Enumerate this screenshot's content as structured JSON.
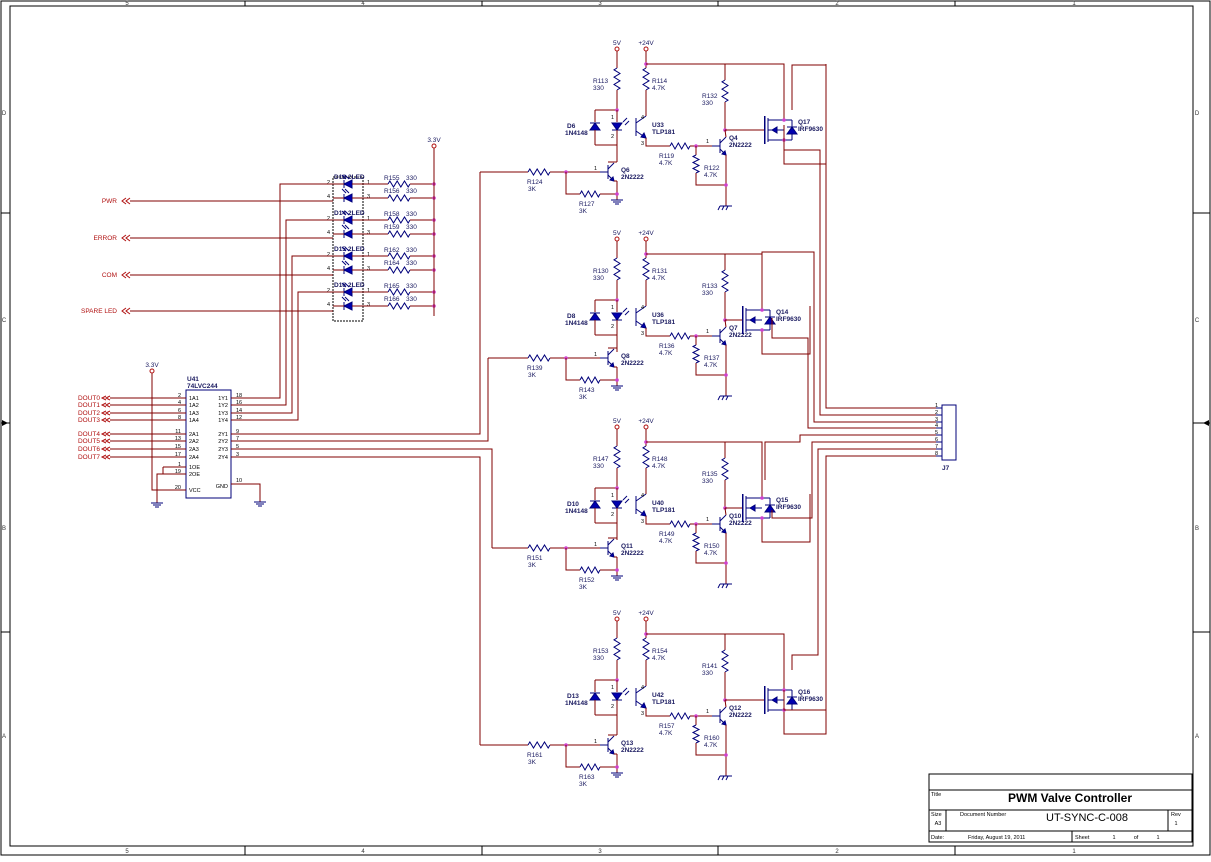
{
  "border": {
    "cols": [
      "5",
      "4",
      "3",
      "2",
      "1"
    ],
    "rows": [
      "D",
      "C",
      "B",
      "A"
    ]
  },
  "title_block": {
    "title_label": "Title",
    "title": "PWM Valve Controller",
    "size_label": "Size",
    "size": "A3",
    "docnum_label": "Document Number",
    "docnum": "UT-SYNC-C-008",
    "rev_label": "Rev",
    "rev": "1",
    "date_label": "Date:",
    "date": "Friday, August 19, 2011",
    "sheet_label": "Sheet",
    "sheet": "1",
    "of_label": "of",
    "of": "1"
  },
  "power": {
    "v33": "3.3V",
    "v5": "5V",
    "v24": "+24V"
  },
  "status_ports": [
    "PWR",
    "ERROR",
    "COM",
    "SPARE LED"
  ],
  "dout_ports": [
    "DOUT0",
    "DOUT1",
    "DOUT2",
    "DOUT3",
    "DOUT4",
    "DOUT5",
    "DOUT6",
    "DOUT7"
  ],
  "buffer": {
    "ref": "U41",
    "part": "74LVC244",
    "left_pins": [
      "1A1",
      "1A2",
      "1A3",
      "1A4",
      "2A1",
      "2A2",
      "2A3",
      "2A4",
      "1OE",
      "2OE",
      "VCC"
    ],
    "left_nums": [
      "2",
      "4",
      "6",
      "8",
      "11",
      "13",
      "15",
      "17",
      "1",
      "19",
      "20"
    ],
    "right_pins": [
      "1Y1",
      "1Y2",
      "1Y3",
      "1Y4",
      "2Y1",
      "2Y2",
      "2Y3",
      "2Y4",
      "GND"
    ],
    "right_nums": [
      "18",
      "16",
      "14",
      "12",
      "9",
      "7",
      "5",
      "3",
      "10"
    ]
  },
  "leds": [
    {
      "ref": "D12",
      "part": "2LED",
      "r1": "R155",
      "v1": "330",
      "r2": "R156",
      "v2": "330"
    },
    {
      "ref": "D14",
      "part": "2LED",
      "r1": "R158",
      "v1": "330",
      "r2": "R159",
      "v2": "330"
    },
    {
      "ref": "D15",
      "part": "2LED",
      "r1": "R162",
      "v1": "330",
      "r2": "R164",
      "v2": "330"
    },
    {
      "ref": "D16",
      "part": "2LED",
      "r1": "R165",
      "v1": "330",
      "r2": "R166",
      "v2": "330"
    }
  ],
  "led_pins": {
    "in_a": "2",
    "in_b": "4",
    "out_a": "1",
    "out_b": "3"
  },
  "channels": [
    {
      "r_top_left": "R113",
      "r_top_left_v": "330",
      "r_top_mid": "R114",
      "r_top_mid_v": "4.7K",
      "diode": "D6",
      "diode_part": "1N4148",
      "opto": "U33",
      "opto_part": "TLP181",
      "r_pull": "R132",
      "r_pull_v": "330",
      "q_drv": "Q4",
      "q_drv_part": "2N2222",
      "r_base": "R119",
      "r_base_v": "4.7K",
      "r_be": "R122",
      "r_be_v": "4.7K",
      "q_in": "Q6",
      "q_in_part": "2N2222",
      "r_in": "R124",
      "r_in_v": "3K",
      "r_in2": "R127",
      "r_in2_v": "3K",
      "fet": "Q17",
      "fet_part": "IRF9630"
    },
    {
      "r_top_left": "R130",
      "r_top_left_v": "330",
      "r_top_mid": "R131",
      "r_top_mid_v": "4.7K",
      "diode": "D8",
      "diode_part": "1N4148",
      "opto": "U36",
      "opto_part": "TLP181",
      "r_pull": "R133",
      "r_pull_v": "330",
      "q_drv": "Q7",
      "q_drv_part": "2N2222",
      "r_base": "R136",
      "r_base_v": "4.7K",
      "r_be": "R137",
      "r_be_v": "4.7K",
      "q_in": "Q8",
      "q_in_part": "2N2222",
      "r_in": "R139",
      "r_in_v": "3K",
      "r_in2": "R143",
      "r_in2_v": "3K",
      "fet": "Q14",
      "fet_part": "IRF9630"
    },
    {
      "r_top_left": "R147",
      "r_top_left_v": "330",
      "r_top_mid": "R148",
      "r_top_mid_v": "4.7K",
      "diode": "D10",
      "diode_part": "1N4148",
      "opto": "U40",
      "opto_part": "TLP181",
      "r_pull": "R135",
      "r_pull_v": "330",
      "q_drv": "Q10",
      "q_drv_part": "2N2222",
      "r_base": "R149",
      "r_base_v": "4.7K",
      "r_be": "R150",
      "r_be_v": "4.7K",
      "q_in": "Q11",
      "q_in_part": "2N2222",
      "r_in": "R151",
      "r_in_v": "3K",
      "r_in2": "R152",
      "r_in2_v": "3K",
      "fet": "Q15",
      "fet_part": "IRF9630"
    },
    {
      "r_top_left": "R153",
      "r_top_left_v": "330",
      "r_top_mid": "R154",
      "r_top_mid_v": "4.7K",
      "diode": "D13",
      "diode_part": "1N4148",
      "opto": "U42",
      "opto_part": "TLP181",
      "r_pull": "R141",
      "r_pull_v": "330",
      "q_drv": "Q12",
      "q_drv_part": "2N2222",
      "r_base": "R157",
      "r_base_v": "4.7K",
      "r_be": "R160",
      "r_be_v": "4.7K",
      "q_in": "Q13",
      "q_in_part": "2N2222",
      "r_in": "R161",
      "r_in_v": "3K",
      "r_in2": "R163",
      "r_in2_v": "3K",
      "fet": "Q16",
      "fet_part": "IRF9630"
    }
  ],
  "opto_pins": {
    "p1": "1",
    "p2": "2",
    "p3": "3",
    "p4": "4"
  },
  "transistor_pins": {
    "b": "1",
    "c": "3",
    "e": "2"
  },
  "connector": {
    "ref": "J7",
    "pins": [
      "1",
      "2",
      "3",
      "4",
      "5",
      "6",
      "7",
      "8"
    ]
  },
  "colors": {
    "wire": "#800000",
    "symbol": "#00007a",
    "port": "#b01010",
    "junction": "#d040d0"
  }
}
